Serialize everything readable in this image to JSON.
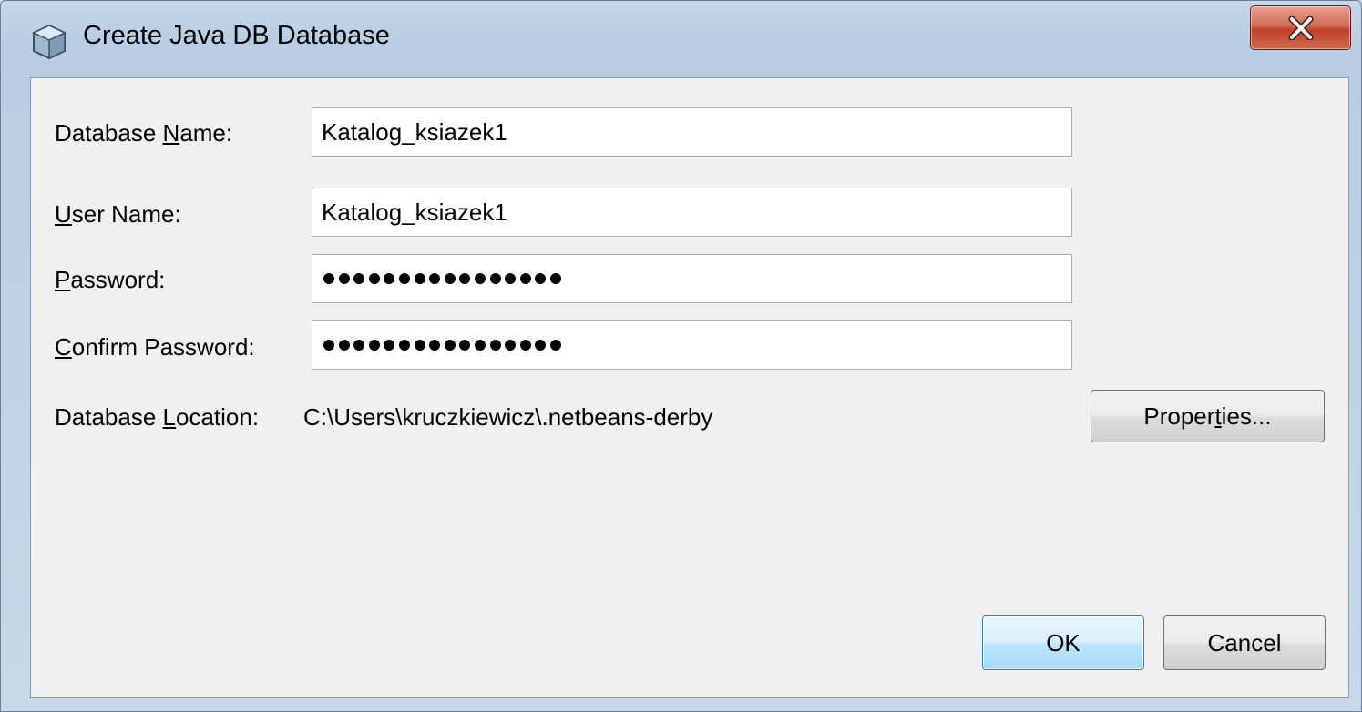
{
  "window": {
    "title": "Create Java DB Database",
    "icon": "java-db-cube-icon",
    "close_icon": "close-x-icon"
  },
  "form": {
    "database_name": {
      "label_pre": "Database ",
      "label_mnemonic": "N",
      "label_post": "ame:",
      "value": "Katalog_ksiazek1"
    },
    "user_name": {
      "label_pre": "",
      "label_mnemonic": "U",
      "label_post": "ser Name:",
      "value": "Katalog_ksiazek1"
    },
    "password": {
      "label_pre": "",
      "label_mnemonic": "P",
      "label_post": "assword:",
      "masked_length": 16
    },
    "confirm_password": {
      "label_pre": "",
      "label_mnemonic": "C",
      "label_post": "onfirm Password:",
      "masked_length": 16
    },
    "database_location": {
      "label_pre": "Database ",
      "label_mnemonic": "L",
      "label_post": "ocation:",
      "value": "C:\\Users\\kruczkiewicz\\.netbeans-derby"
    }
  },
  "buttons": {
    "properties": {
      "pre": "Proper",
      "mnemonic": "t",
      "post": "ies..."
    },
    "ok": "OK",
    "cancel": "Cancel"
  },
  "colors": {
    "dialog_background": "#f0f0f0",
    "close_button_red": "#c9503a",
    "ok_button_border": "#3c7fb1"
  }
}
